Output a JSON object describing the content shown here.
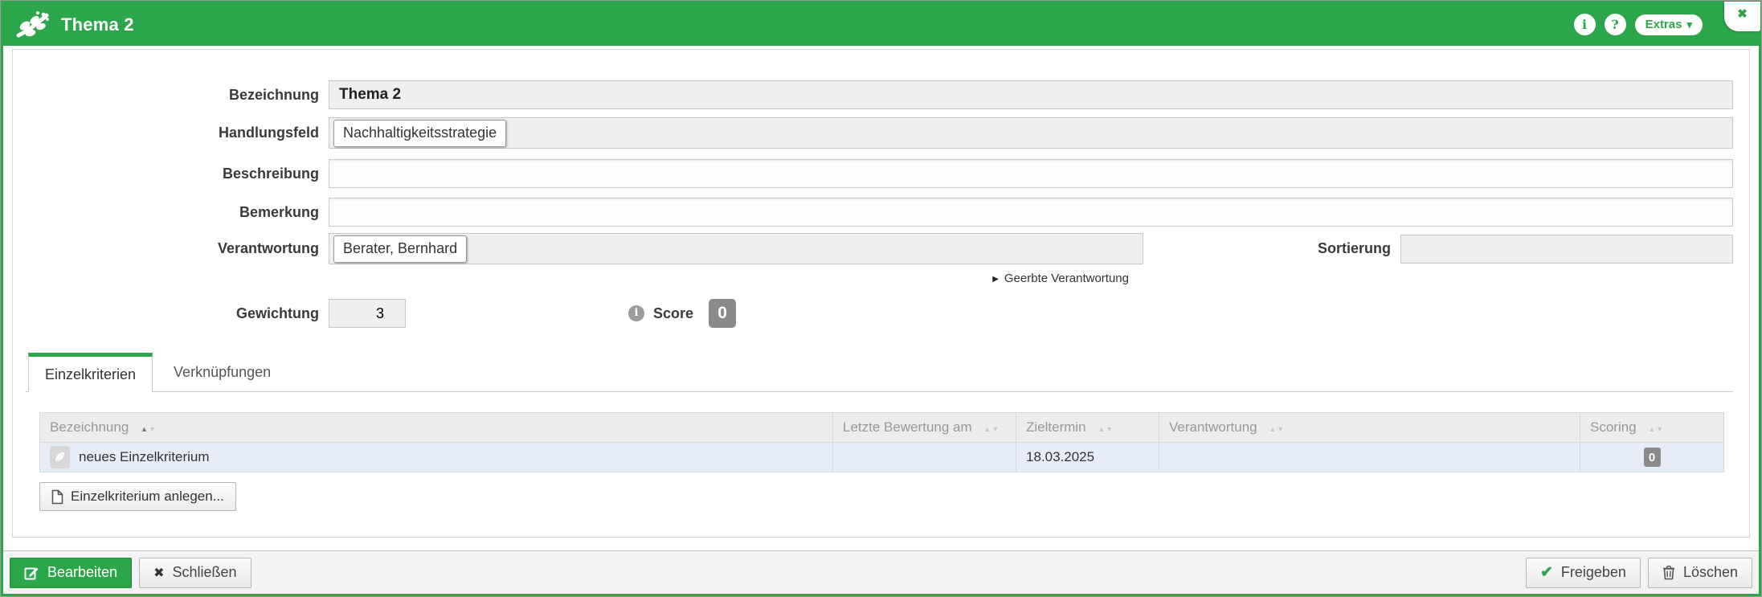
{
  "titlebar": {
    "title": "Thema 2",
    "logo_icon": "leaf-branch-icon",
    "info_icon": "info-circle-icon",
    "help_icon": "question-circle-icon",
    "extras_label": "Extras",
    "close_icon": "close-x-icon"
  },
  "form": {
    "bezeichnung_label": "Bezeichnung",
    "bezeichnung_value": "Thema 2",
    "handlungsfeld_label": "Handlungsfeld",
    "handlungsfeld_chip": "Nachhaltigkeitsstrategie",
    "beschreibung_label": "Beschreibung",
    "beschreibung_value": "",
    "bemerkung_label": "Bemerkung",
    "bemerkung_value": "",
    "verantwortung_label": "Verantwortung",
    "verantwortung_chip": "Berater, Bernhard",
    "sortierung_label": "Sortierung",
    "sortierung_value": "",
    "inherited_link": "Geerbte Verantwortung",
    "gewichtung_label": "Gewichtung",
    "gewichtung_value": "3",
    "score_info_icon": "info-circle-icon",
    "score_label": "Score",
    "score_value": "0"
  },
  "tabs": {
    "einzelkriterien": "Einzelkriterien",
    "verknuepfungen": "Verknüpfungen"
  },
  "table": {
    "columns": [
      "Bezeichnung",
      "Letzte Bewertung am",
      "Zieltermin",
      "Verantwortung",
      "Scoring"
    ],
    "sorted_column": "Bezeichnung",
    "sort_direction": "asc",
    "row": {
      "icon": "leaf-document-icon",
      "bezeichnung": "neues Einzelkriterium",
      "letzte_bewertung_am": "",
      "zieltermin": "18.03.2025",
      "verantwortung": "",
      "scoring": "0"
    }
  },
  "buttons": {
    "anlegen": "Einzelkriterium anlegen...",
    "bearbeiten": "Bearbeiten",
    "schliessen": "Schließen",
    "freigeben": "Freigeben",
    "loeschen": "Löschen"
  },
  "colors": {
    "accent_green": "#2ba64a",
    "badge_gray": "#8a8a8a",
    "row_highlight": "#e7edf8"
  }
}
